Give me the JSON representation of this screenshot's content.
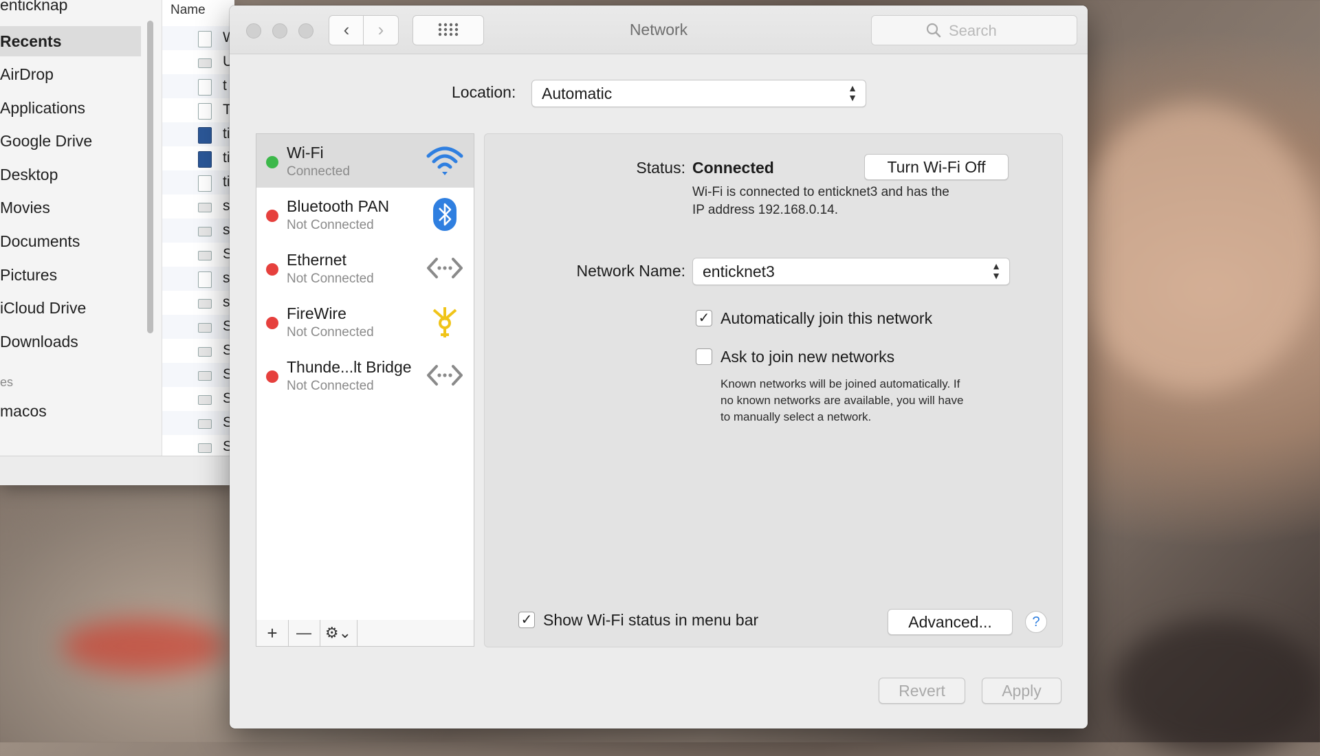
{
  "finder": {
    "title": "enticknap",
    "sidebar": [
      {
        "label": "Recents",
        "active": true
      },
      {
        "label": "AirDrop"
      },
      {
        "label": "Applications"
      },
      {
        "label": "Google Drive"
      },
      {
        "label": "Desktop"
      },
      {
        "label": "Movies"
      },
      {
        "label": "Documents"
      },
      {
        "label": "Pictures"
      },
      {
        "label": "iCloud Drive"
      },
      {
        "label": "Downloads"
      }
    ],
    "section_label": "es",
    "device": "macos",
    "column_header": "Name",
    "rows": [
      "W",
      "U",
      "t",
      "T",
      "ti",
      "ti",
      "ti",
      "s",
      "s",
      "S",
      "s",
      "s",
      "S",
      "S",
      "S",
      "S",
      "S",
      "S"
    ]
  },
  "window": {
    "title": "Network",
    "search_placeholder": "Search",
    "back": "‹",
    "forward": "›",
    "grid": "⠿"
  },
  "location": {
    "label": "Location:",
    "value": "Automatic"
  },
  "services": [
    {
      "name": "Wi-Fi",
      "status": "Connected",
      "dot": "#3cb84a",
      "icon": "wifi-icon",
      "selected": true
    },
    {
      "name": "Bluetooth PAN",
      "status": "Not Connected",
      "dot": "#e6403d",
      "icon": "bluetooth-icon"
    },
    {
      "name": "Ethernet",
      "status": "Not Connected",
      "dot": "#e6403d",
      "icon": "ethernet-icon"
    },
    {
      "name": "FireWire",
      "status": "Not Connected",
      "dot": "#e6403d",
      "icon": "firewire-icon"
    },
    {
      "name": "Thunde...lt Bridge",
      "status": "Not Connected",
      "dot": "#e6403d",
      "icon": "thunderbolt-bridge-icon"
    }
  ],
  "toolbar": {
    "add": "+",
    "remove": "—",
    "gear": "⚙︎⌄"
  },
  "detail": {
    "status_label": "Status:",
    "status_value": "Connected",
    "turn_off_button": "Turn Wi-Fi Off",
    "status_desc_1": "Wi-Fi is connected to enticknet3 and has the",
    "status_desc_2": "IP address 192.168.0.14.",
    "network_name_label": "Network Name:",
    "network_name_value": "enticknet3",
    "auto_join_label": "Automatically join this network",
    "auto_join_checked": true,
    "ask_join_label": "Ask to join new networks",
    "ask_join_checked": false,
    "ask_join_desc_1": "Known networks will be joined automatically. If",
    "ask_join_desc_2": "no known networks are available, you will have",
    "ask_join_desc_3": "to manually select a network.",
    "show_status_label": "Show Wi-Fi status in menu bar",
    "show_status_checked": true,
    "advanced_button": "Advanced...",
    "help_button": "?"
  },
  "footer": {
    "revert": "Revert",
    "apply": "Apply"
  },
  "colors": {
    "accent": "#2f7fe0",
    "connected": "#3cb84a",
    "disconnected": "#e6403d",
    "firewire": "#f0c419"
  }
}
